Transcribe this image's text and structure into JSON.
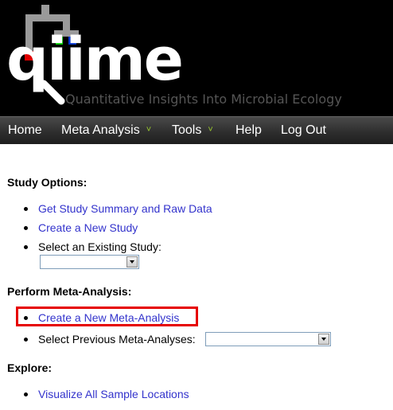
{
  "header": {
    "logo_word": "qiime",
    "tagline": "Quantitative Insights Into Microbial Ecology",
    "colors": {
      "red": "#e00000",
      "green": "#00cc00",
      "blue": "#0033cc",
      "gray": "#9a9a9a"
    }
  },
  "nav": {
    "items": [
      {
        "label": "Home",
        "dropdown": false
      },
      {
        "label": "Meta Analysis",
        "dropdown": true
      },
      {
        "label": "Tools",
        "dropdown": true
      },
      {
        "label": "Help",
        "dropdown": false
      },
      {
        "label": "Log Out",
        "dropdown": false
      }
    ],
    "caret_glyph": "˅"
  },
  "study_options": {
    "title": "Study Options:",
    "summary_link": "Get Study Summary and Raw Data",
    "create_study_link": "Create a New Study",
    "select_existing_label": "Select an Existing Study:",
    "select_existing_value": ""
  },
  "meta_analysis": {
    "title": "Perform Meta-Analysis:",
    "create_link": "Create a New Meta-Analysis",
    "select_previous_label": "Select Previous Meta-Analyses:",
    "select_previous_value": ""
  },
  "explore": {
    "title": "Explore:",
    "visualize_link": "Visualize All Sample Locations"
  }
}
